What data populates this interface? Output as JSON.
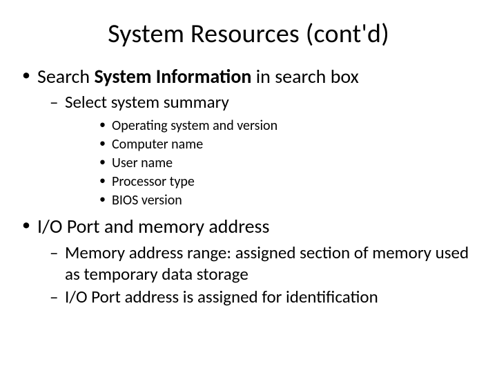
{
  "title": "System Resources (cont'd)",
  "b1": {
    "prefix": "Search ",
    "bold": "System Information",
    "suffix": " in search box",
    "sub1": "Select system summary",
    "sub1_items": [
      "Operating system and version",
      "Computer name",
      "User name",
      "Processor type",
      "BIOS version"
    ]
  },
  "b2": {
    "text": "I/O Port and memory address",
    "subs": [
      "Memory address range: assigned section of memory used as temporary data storage",
      "I/O Port address is assigned for identification"
    ]
  }
}
